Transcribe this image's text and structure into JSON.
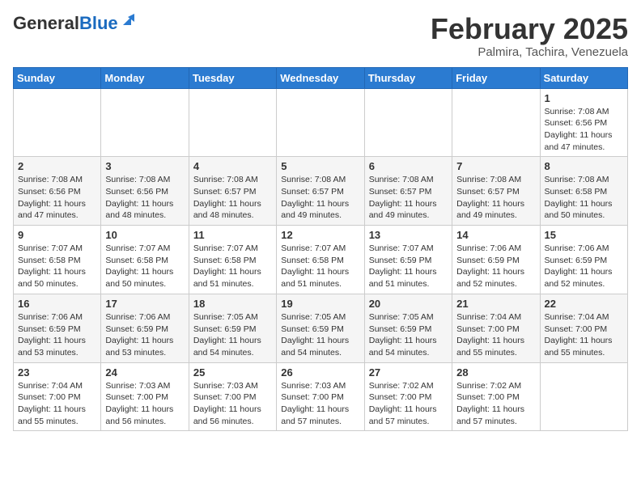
{
  "header": {
    "logo_general": "General",
    "logo_blue": "Blue",
    "month_title": "February 2025",
    "subtitle": "Palmira, Tachira, Venezuela"
  },
  "days_of_week": [
    "Sunday",
    "Monday",
    "Tuesday",
    "Wednesday",
    "Thursday",
    "Friday",
    "Saturday"
  ],
  "weeks": [
    [
      {
        "day": "",
        "info": ""
      },
      {
        "day": "",
        "info": ""
      },
      {
        "day": "",
        "info": ""
      },
      {
        "day": "",
        "info": ""
      },
      {
        "day": "",
        "info": ""
      },
      {
        "day": "",
        "info": ""
      },
      {
        "day": "1",
        "info": "Sunrise: 7:08 AM\nSunset: 6:56 PM\nDaylight: 11 hours\nand 47 minutes."
      }
    ],
    [
      {
        "day": "2",
        "info": "Sunrise: 7:08 AM\nSunset: 6:56 PM\nDaylight: 11 hours\nand 47 minutes."
      },
      {
        "day": "3",
        "info": "Sunrise: 7:08 AM\nSunset: 6:56 PM\nDaylight: 11 hours\nand 48 minutes."
      },
      {
        "day": "4",
        "info": "Sunrise: 7:08 AM\nSunset: 6:57 PM\nDaylight: 11 hours\nand 48 minutes."
      },
      {
        "day": "5",
        "info": "Sunrise: 7:08 AM\nSunset: 6:57 PM\nDaylight: 11 hours\nand 49 minutes."
      },
      {
        "day": "6",
        "info": "Sunrise: 7:08 AM\nSunset: 6:57 PM\nDaylight: 11 hours\nand 49 minutes."
      },
      {
        "day": "7",
        "info": "Sunrise: 7:08 AM\nSunset: 6:57 PM\nDaylight: 11 hours\nand 49 minutes."
      },
      {
        "day": "8",
        "info": "Sunrise: 7:08 AM\nSunset: 6:58 PM\nDaylight: 11 hours\nand 50 minutes."
      }
    ],
    [
      {
        "day": "9",
        "info": "Sunrise: 7:07 AM\nSunset: 6:58 PM\nDaylight: 11 hours\nand 50 minutes."
      },
      {
        "day": "10",
        "info": "Sunrise: 7:07 AM\nSunset: 6:58 PM\nDaylight: 11 hours\nand 50 minutes."
      },
      {
        "day": "11",
        "info": "Sunrise: 7:07 AM\nSunset: 6:58 PM\nDaylight: 11 hours\nand 51 minutes."
      },
      {
        "day": "12",
        "info": "Sunrise: 7:07 AM\nSunset: 6:58 PM\nDaylight: 11 hours\nand 51 minutes."
      },
      {
        "day": "13",
        "info": "Sunrise: 7:07 AM\nSunset: 6:59 PM\nDaylight: 11 hours\nand 51 minutes."
      },
      {
        "day": "14",
        "info": "Sunrise: 7:06 AM\nSunset: 6:59 PM\nDaylight: 11 hours\nand 52 minutes."
      },
      {
        "day": "15",
        "info": "Sunrise: 7:06 AM\nSunset: 6:59 PM\nDaylight: 11 hours\nand 52 minutes."
      }
    ],
    [
      {
        "day": "16",
        "info": "Sunrise: 7:06 AM\nSunset: 6:59 PM\nDaylight: 11 hours\nand 53 minutes."
      },
      {
        "day": "17",
        "info": "Sunrise: 7:06 AM\nSunset: 6:59 PM\nDaylight: 11 hours\nand 53 minutes."
      },
      {
        "day": "18",
        "info": "Sunrise: 7:05 AM\nSunset: 6:59 PM\nDaylight: 11 hours\nand 54 minutes."
      },
      {
        "day": "19",
        "info": "Sunrise: 7:05 AM\nSunset: 6:59 PM\nDaylight: 11 hours\nand 54 minutes."
      },
      {
        "day": "20",
        "info": "Sunrise: 7:05 AM\nSunset: 6:59 PM\nDaylight: 11 hours\nand 54 minutes."
      },
      {
        "day": "21",
        "info": "Sunrise: 7:04 AM\nSunset: 7:00 PM\nDaylight: 11 hours\nand 55 minutes."
      },
      {
        "day": "22",
        "info": "Sunrise: 7:04 AM\nSunset: 7:00 PM\nDaylight: 11 hours\nand 55 minutes."
      }
    ],
    [
      {
        "day": "23",
        "info": "Sunrise: 7:04 AM\nSunset: 7:00 PM\nDaylight: 11 hours\nand 55 minutes."
      },
      {
        "day": "24",
        "info": "Sunrise: 7:03 AM\nSunset: 7:00 PM\nDaylight: 11 hours\nand 56 minutes."
      },
      {
        "day": "25",
        "info": "Sunrise: 7:03 AM\nSunset: 7:00 PM\nDaylight: 11 hours\nand 56 minutes."
      },
      {
        "day": "26",
        "info": "Sunrise: 7:03 AM\nSunset: 7:00 PM\nDaylight: 11 hours\nand 57 minutes."
      },
      {
        "day": "27",
        "info": "Sunrise: 7:02 AM\nSunset: 7:00 PM\nDaylight: 11 hours\nand 57 minutes."
      },
      {
        "day": "28",
        "info": "Sunrise: 7:02 AM\nSunset: 7:00 PM\nDaylight: 11 hours\nand 57 minutes."
      },
      {
        "day": "",
        "info": ""
      }
    ]
  ]
}
